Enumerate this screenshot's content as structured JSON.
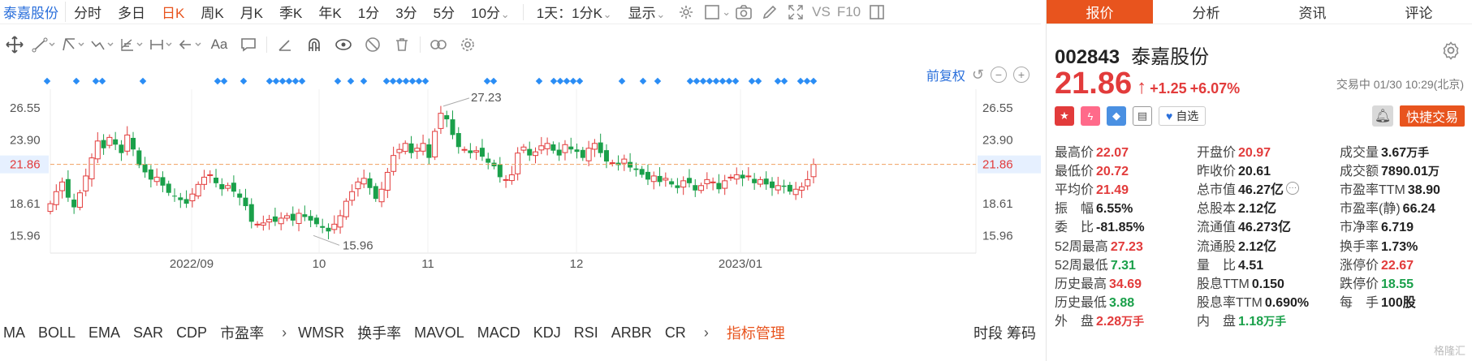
{
  "topbar": {
    "stock_name": "泰嘉股份",
    "periods": [
      "分时",
      "多日",
      "日K",
      "周K",
      "月K",
      "季K",
      "年K",
      "1分",
      "3分",
      "5分"
    ],
    "active_period": "日K",
    "minute_select": "10分",
    "range_select": "1天：1分K",
    "display_label": "显示",
    "vs_label": "VS",
    "f10_label": "F10"
  },
  "chart": {
    "fq_label": "前复权",
    "y_ticks": [
      "26.55",
      "23.90",
      "21.86",
      "18.61",
      "15.96"
    ],
    "current_price_tag": "21.86",
    "x_labels": [
      "2022/09",
      "10",
      "11",
      "12",
      "2023/01"
    ],
    "high_label": "27.23",
    "low_label": "15.96"
  },
  "chart_data": {
    "type": "candlestick",
    "ylim": [
      14.5,
      28.5
    ],
    "reference_line": 21.86,
    "annotations": [
      {
        "text": "27.23",
        "value": 27.23
      },
      {
        "text": "15.96",
        "value": 15.96
      }
    ],
    "x_ticks": [
      "2022/09",
      "10",
      "11",
      "12",
      "2023/01"
    ],
    "y_ticks": [
      26.55,
      23.9,
      21.86,
      18.61,
      15.96
    ]
  },
  "indicators": {
    "items": [
      "MA",
      "BOLL",
      "EMA",
      "SAR",
      "CDP",
      "市盈率",
      "WMSR",
      "换手率",
      "MAVOL",
      "MACD",
      "KDJ",
      "RSI",
      "ARBR",
      "CR"
    ],
    "manage_label": "指标管理",
    "right_label": "时段 筹码"
  },
  "panel": {
    "tabs": [
      "报价",
      "分析",
      "资讯",
      "评论"
    ],
    "active_tab": "报价",
    "code": "002843",
    "name": "泰嘉股份",
    "price": "21.86",
    "change": "+1.25",
    "change_pct": "+6.07%",
    "trade_time": "交易中 01/30 10:29(北京)",
    "watch_label": "自选",
    "quick_trade_label": "快捷交易",
    "stats": [
      [
        {
          "label": "最高价",
          "value": "22.07",
          "color": "red"
        },
        {
          "label": "开盘价",
          "value": "20.97",
          "color": "red"
        },
        {
          "label": "成交量",
          "value": "3.67",
          "unit": "万手",
          "color": ""
        }
      ],
      [
        {
          "label": "最低价",
          "value": "20.72",
          "color": "red"
        },
        {
          "label": "昨收价",
          "value": "20.61",
          "color": ""
        },
        {
          "label": "成交额",
          "value": "7890.01",
          "unit": "万",
          "color": ""
        }
      ],
      [
        {
          "label": "平均价",
          "value": "21.49",
          "color": "red"
        },
        {
          "label": "总市值",
          "value": "46.27亿",
          "color": ""
        },
        {
          "label": "市盈率TTM",
          "value": "38.90",
          "color": ""
        }
      ],
      [
        {
          "label": "振　幅",
          "value": "6.55%",
          "color": ""
        },
        {
          "label": "总股本",
          "value": "2.12亿",
          "color": ""
        },
        {
          "label": "市盈率(静)",
          "value": "66.24",
          "color": ""
        }
      ],
      [
        {
          "label": "委　比",
          "value": "-81.85%",
          "color": ""
        },
        {
          "label": "流通值",
          "value": "46.273亿",
          "color": ""
        },
        {
          "label": "市净率",
          "value": "6.719",
          "color": ""
        }
      ],
      [
        {
          "label": "52周最高",
          "value": "27.23",
          "color": "red"
        },
        {
          "label": "流通股",
          "value": "2.12亿",
          "color": ""
        },
        {
          "label": "换手率",
          "value": "1.73%",
          "color": ""
        }
      ],
      [
        {
          "label": "52周最低",
          "value": "7.31",
          "color": "green"
        },
        {
          "label": "量　比",
          "value": "4.51",
          "color": ""
        },
        {
          "label": "涨停价",
          "value": "22.67",
          "color": "red"
        }
      ],
      [
        {
          "label": "历史最高",
          "value": "34.69",
          "color": "red"
        },
        {
          "label": "股息TTM",
          "value": "0.150",
          "color": ""
        },
        {
          "label": "跌停价",
          "value": "18.55",
          "color": "green"
        }
      ],
      [
        {
          "label": "历史最低",
          "value": "3.88",
          "color": "green"
        },
        {
          "label": "股息率TTM",
          "value": "0.690%",
          "color": ""
        },
        {
          "label": "每　手",
          "value": "100股",
          "color": ""
        }
      ],
      [
        {
          "label": "外　盘",
          "value": "2.28",
          "unit": "万手",
          "color": "red"
        },
        {
          "label": "内　盘",
          "value": "1.18",
          "unit": "万手",
          "color": "green"
        },
        null
      ]
    ],
    "watermark": "格隆汇"
  },
  "colors": {
    "accent": "#e8541e",
    "up": "#e23b3b",
    "down": "#1aa04a",
    "link": "#2a6fdb",
    "marker": "#2a8df5"
  }
}
